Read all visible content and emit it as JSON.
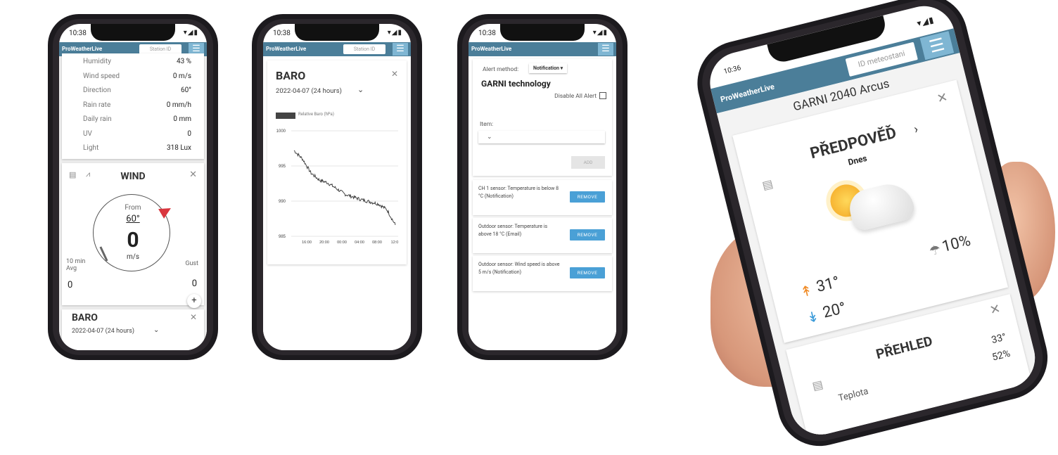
{
  "phone1": {
    "time": "10:38",
    "status_icons": "▾◢▮",
    "logo": "ProWeatherLive",
    "station_placeholder": "Station ID",
    "readings": [
      {
        "label": "Humidity",
        "value": "43 %"
      },
      {
        "label": "Wind speed",
        "value": "0 m/s"
      },
      {
        "label": "Direction",
        "value": "60°"
      },
      {
        "label": "Rain rate",
        "value": "0 mm/h"
      },
      {
        "label": "Daily rain",
        "value": "0 mm"
      },
      {
        "label": "UV",
        "value": "0"
      },
      {
        "label": "Light",
        "value": "318 Lux"
      }
    ],
    "wind": {
      "title": "WIND",
      "from_label": "From",
      "from_value": "60°",
      "speed": "0",
      "unit": "m/s",
      "avg_label": "10 min Avg",
      "avg_value": "0",
      "gust_label": "Gust",
      "gust_value": "0"
    },
    "baro_title": "BARO",
    "baro_date": "2022-04-07 (24 hours)"
  },
  "phone2": {
    "time": "10:38",
    "logo": "ProWeatherLive",
    "station_placeholder": "Station ID",
    "title": "BARO",
    "date": "2022-04-07 (24 hours)",
    "legend": "Relative Baro (hPa)"
  },
  "chart_data": {
    "type": "line",
    "title": "BARO",
    "series": [
      {
        "name": "Relative Baro (hPa)",
        "x": [
          "12:00",
          "14:00",
          "16:00",
          "18:00",
          "20:00",
          "22:00",
          "00:00",
          "02:00",
          "04:00",
          "06:00",
          "08:00",
          "10:00",
          "12:00"
        ],
        "values": [
          997.2,
          996.0,
          994.0,
          993.0,
          992.6,
          991.8,
          991.0,
          990.6,
          990.2,
          989.9,
          989.6,
          988.8,
          986.6
        ]
      }
    ],
    "x_ticks": [
      "16:00",
      "20:00",
      "00:00",
      "04:00",
      "08:00",
      "12:0"
    ],
    "y_ticks": [
      1000,
      995,
      990,
      985
    ],
    "ylim": [
      985,
      1000
    ]
  },
  "phone3": {
    "time": "10:38",
    "logo": "ProWeatherLive",
    "station_placeholder": "Station ID",
    "alert_method_label": "Alert method:",
    "alert_method_value": "Notification ▾",
    "brand": "GARNI technology",
    "disable_all": "Disable All Alert",
    "item_label": "Item:",
    "add_label": "ADD",
    "alerts": [
      {
        "text": "CH 1 sensor: Temperature is below 8 °C (Notification)",
        "button": "REMOVE"
      },
      {
        "text": "Outdoor sensor: Temperature is above 18 °C (Email)",
        "button": "REMOVE"
      },
      {
        "text": "Outdoor sensor: Wind speed is above 5 m/s (Notification)",
        "button": "REMOVE"
      }
    ]
  },
  "phone4": {
    "time": "10:36",
    "logo": "ProWeatherLive",
    "station_placeholder": "ID meteostani",
    "station_name": "GARNI 2040 Arcus",
    "forecast_title": "PŘEDPOVĚĎ",
    "forecast_day": "Dnes",
    "temp_max": "31°",
    "temp_min": "20°",
    "rain_prob": "10%",
    "overview_title": "PŘEHLED",
    "overview_row_label": "Teplota",
    "overview_val1": "33°",
    "overview_val2": "52%"
  },
  "colors": {
    "appbar": "#4b7e99",
    "button": "#4aa0d6",
    "wind_arrow": "#d9363e",
    "temp_up": "#f08a24",
    "temp_down": "#3a9ad9"
  }
}
